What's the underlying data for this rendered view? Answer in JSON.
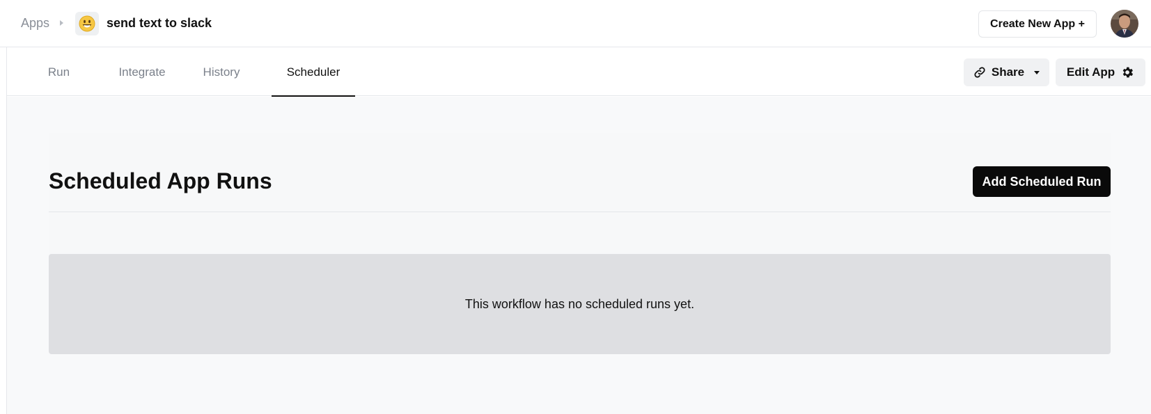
{
  "header": {
    "breadcrumb_root": "Apps",
    "app_emoji": "😃",
    "app_name": "send text to slack",
    "create_button": "Create New App +"
  },
  "tabs": [
    {
      "label": "Run",
      "active": false
    },
    {
      "label": "Integrate",
      "active": false
    },
    {
      "label": "History",
      "active": false
    },
    {
      "label": "Scheduler",
      "active": true
    }
  ],
  "toolbar": {
    "share_label": "Share",
    "edit_label": "Edit App"
  },
  "main": {
    "title": "Scheduled App Runs",
    "add_button": "Add Scheduled Run",
    "empty_message": "This workflow has no scheduled runs yet."
  },
  "icons": {
    "share": "link-icon",
    "share_dropdown": "caret-down-icon",
    "edit": "gear-icon",
    "breadcrumb_separator": "chevron-right-icon"
  },
  "colors": {
    "primary_button": "#0a0a0a",
    "main_background": "#f8f9fa",
    "empty_state_background": "#dedfe2"
  }
}
